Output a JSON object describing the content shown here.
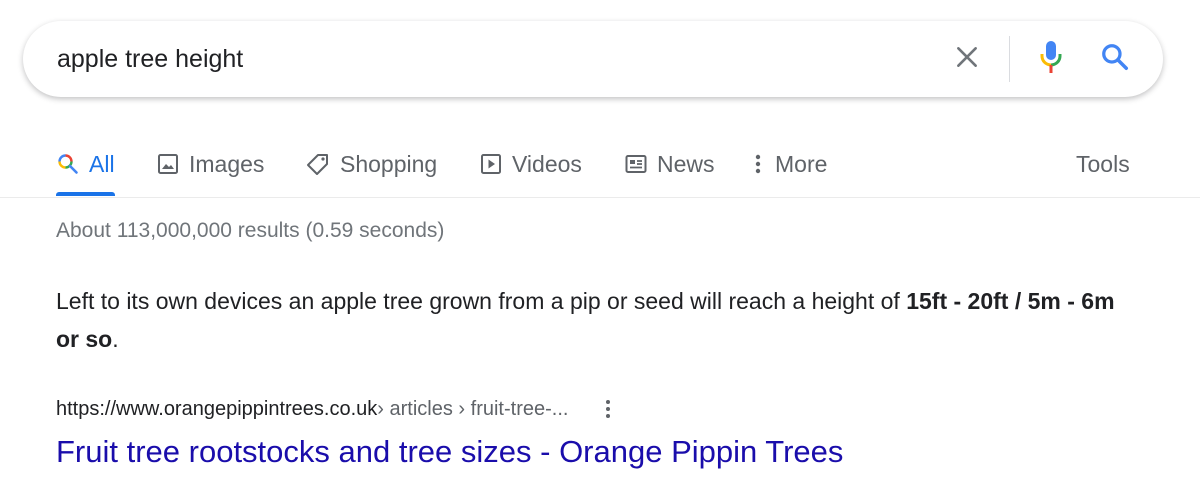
{
  "search": {
    "query": "apple tree height"
  },
  "icons": {
    "clear": "close-icon",
    "mic": "mic-icon",
    "search": "search-icon"
  },
  "tabs": [
    {
      "label": "All",
      "icon": "search-icon",
      "active": true
    },
    {
      "label": "Images",
      "icon": "image-icon"
    },
    {
      "label": "Shopping",
      "icon": "tag-icon"
    },
    {
      "label": "Videos",
      "icon": "play-icon"
    },
    {
      "label": "News",
      "icon": "newspaper-icon"
    },
    {
      "label": "More",
      "icon": "kebab-icon"
    }
  ],
  "tools_label": "Tools",
  "results": {
    "stats": "About 113,000,000 results (0.59 seconds)",
    "featured_snippet": {
      "text_before": "Left to its own devices an apple tree grown from a pip or seed will reach a height of ",
      "bold": "15ft - 20ft / 5m - 6m or so",
      "text_after": "."
    },
    "first_result": {
      "cite_domain": "https://www.orangepippintrees.co.uk",
      "cite_path": " › articles › fruit-tree-...",
      "title": "Fruit tree rootstocks and tree sizes - Orange Pippin Trees"
    }
  },
  "colors": {
    "link": "#1a0dab",
    "accent": "#1a73e8",
    "muted": "#70757a",
    "text": "#202124"
  }
}
